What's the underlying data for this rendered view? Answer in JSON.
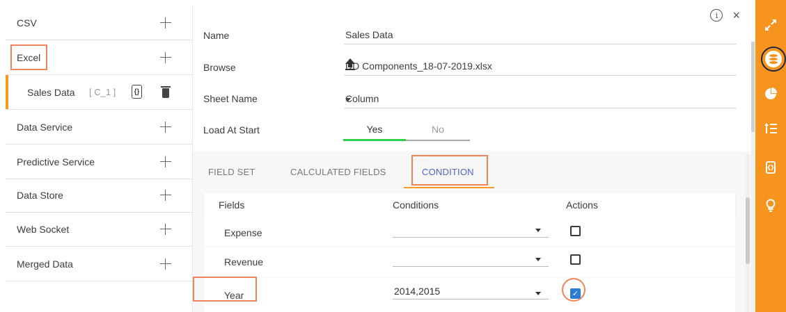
{
  "sidebar": {
    "items": [
      {
        "label": "CSV"
      },
      {
        "label": "Excel"
      },
      {
        "label": "Data Service"
      },
      {
        "label": "Predictive Service"
      },
      {
        "label": "Data Store"
      },
      {
        "label": "Web Socket"
      },
      {
        "label": "Merged Data"
      }
    ],
    "sub_item": {
      "label": "Sales Data",
      "tag": "[ C_1 ]",
      "code_glyph": "{}"
    }
  },
  "header": {
    "info_glyph": "i",
    "close_glyph": "×"
  },
  "form": {
    "name_label": "Name",
    "name_value": "Sales Data",
    "browse_label": "Browse",
    "browse_value": "DD Components_18-07-2019.xlsx",
    "sheet_label": "Sheet Name",
    "sheet_value": "Column",
    "load_label": "Load At Start",
    "load_yes": "Yes",
    "load_no": "No",
    "load_selected": "Yes"
  },
  "tabs": [
    {
      "label": "FIELD SET",
      "active": false
    },
    {
      "label": "CALCULATED FIELDS",
      "active": false
    },
    {
      "label": "CONDITION",
      "active": true
    }
  ],
  "table": {
    "headers": [
      "Fields",
      "Conditions",
      "Actions"
    ],
    "rows": [
      {
        "field": "Expense",
        "condition": "",
        "checked": false
      },
      {
        "field": "Revenue",
        "condition": "",
        "checked": false
      },
      {
        "field": "Year",
        "condition": "2014,2015",
        "checked": true
      }
    ]
  },
  "rail": {
    "icons": [
      "expand-icon",
      "database-icon",
      "pie-chart-icon",
      "sort-list-icon",
      "code-icon",
      "lightbulb-icon"
    ],
    "active": "database-icon",
    "accent": "#f7941d"
  },
  "colors": {
    "highlight": "#f0825c",
    "active_tab": "#5361c9",
    "toggle_on": "#2fd14a",
    "checkbox": "#2b7cd3"
  }
}
